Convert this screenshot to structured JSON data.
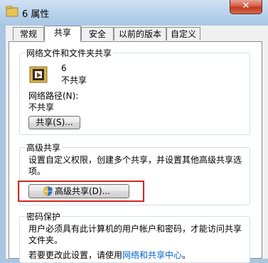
{
  "window": {
    "title": "6 属性",
    "close_label": "✕"
  },
  "tabs": [
    {
      "label": "常规",
      "active": false
    },
    {
      "label": "共享",
      "active": true
    },
    {
      "label": "安全",
      "active": false
    },
    {
      "label": "以前的版本",
      "active": false
    },
    {
      "label": "自定义",
      "active": false
    }
  ],
  "network_sharing": {
    "group_title": "网络文件和文件夹共享",
    "folder_name": "6",
    "folder_status": "不共享",
    "path_label": "网络路径(N):",
    "path_value": "不共享",
    "share_button": "共享(S)..."
  },
  "advanced_sharing": {
    "group_title": "高级共享",
    "description_line1": "设置自定义权限，创建多个共享，并设置其他高级共享选",
    "description_line2": "项。",
    "button_label": "高级共享(D)..."
  },
  "password_protection": {
    "group_title": "密码保护",
    "description_line1": "用户必须具有此计算机的用户帐户和密码，才能访问共享",
    "description_line2": "文件夹。",
    "change_prefix": "若要更改此设置，请使用",
    "change_link": "网络和共享中心",
    "change_suffix": "。"
  },
  "colors": {
    "highlight": "#d0281c",
    "link": "#0066cc"
  }
}
